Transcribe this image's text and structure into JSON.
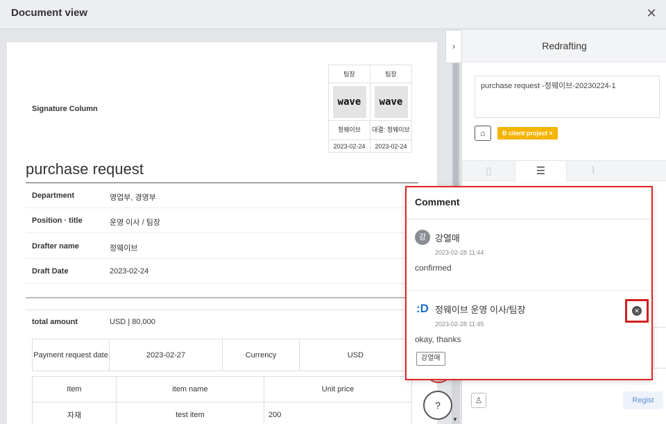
{
  "window": {
    "title": "Document view",
    "close_icon": "close-icon"
  },
  "document": {
    "signature": {
      "label": "Signature Column",
      "columns": [
        {
          "role": "팀장",
          "stamp": "wave",
          "name": "정웨이브",
          "date": "2023-02-24"
        },
        {
          "role": "팀장",
          "stamp": "wave",
          "name": "대결: 정웨이브",
          "date": "2023-02-24"
        }
      ]
    },
    "title": "purchase request",
    "info": [
      {
        "key": "Department",
        "value": "영업부, 경영부"
      },
      {
        "key": "Position · title",
        "value": "운영 이사 / 팀장"
      },
      {
        "key": "Drafter name",
        "value": "정웨이브"
      },
      {
        "key": "Draft Date",
        "value": "2023-02-24"
      }
    ],
    "total": {
      "key": "total amount",
      "value": "USD | 80,000"
    },
    "payment": {
      "date_label": "Payment request date",
      "date_value": "2023-02-27",
      "currency_label": "Currency",
      "currency_value": "USD"
    },
    "items": {
      "headers": [
        "Item",
        "item name",
        "Unit price"
      ],
      "rows": [
        [
          "자재",
          "test item",
          "200"
        ]
      ]
    }
  },
  "panel": {
    "collapse_icon": "chevron-right-icon",
    "header": "Redrafting",
    "subject": "purchase request -정웨이브-20230224-1",
    "tag": "B client project ×",
    "tabs": [
      "document-icon",
      "comment-icon",
      "attachment-icon"
    ],
    "regist": "Regist"
  },
  "comment_popup": {
    "title": "Comment",
    "comments": [
      {
        "avatar": "강",
        "name": "강열매",
        "time": "2023-02-28 11:44",
        "message": "confirmed"
      },
      {
        "avatar": ":D",
        "name": "정웨이브 운영 이사/팀장",
        "time": "2023-02-28 11:45",
        "message": "okay, thanks",
        "mention": "강열매"
      }
    ]
  },
  "colors": {
    "accent": "#e02424",
    "tag": "#f5b400",
    "regist_text": "#5a8fd0"
  }
}
